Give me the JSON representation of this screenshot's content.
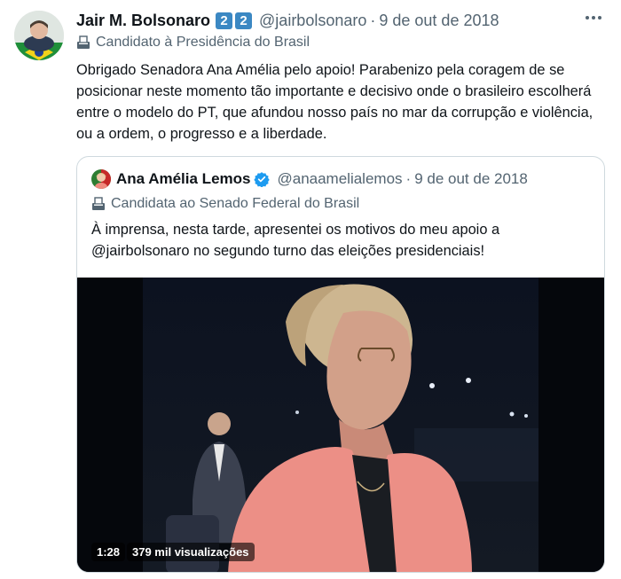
{
  "tweet": {
    "author_name": "Jair M. Bolsonaro",
    "flag_badges": [
      "2",
      "2"
    ],
    "handle": "@jairbolsonaro",
    "separator": "·",
    "date": "9 de out de 2018",
    "label": "Candidato à Presidência do Brasil",
    "more_icon": "more-icon",
    "text": "Obrigado Senadora Ana Amélia pelo apoio! Parabenizo pela coragem de se posicionar neste momento tão importante e decisivo onde o brasileiro escolherá entre o modelo do PT, que afundou nosso país no mar da corrupção e violência, ou a ordem, o progresso e a liberdade."
  },
  "quote": {
    "author_name": "Ana Amélia Lemos",
    "handle": "@anaamelialemos",
    "separator": "·",
    "date": "9 de out de 2018",
    "label": "Candidata ao Senado Federal do Brasil",
    "text": "À imprensa, nesta tarde, apresentei os motivos do meu apoio a @jairbolsonaro no segundo turno das eleições presidenciais!",
    "video": {
      "duration": "1:28",
      "views": "379 mil visualizações"
    }
  },
  "colors": {
    "text_primary": "#0f1419",
    "text_secondary": "#536471",
    "border": "#cfd9de",
    "verified": "#1d9bf0",
    "flag_badge": "#3b88c3"
  }
}
